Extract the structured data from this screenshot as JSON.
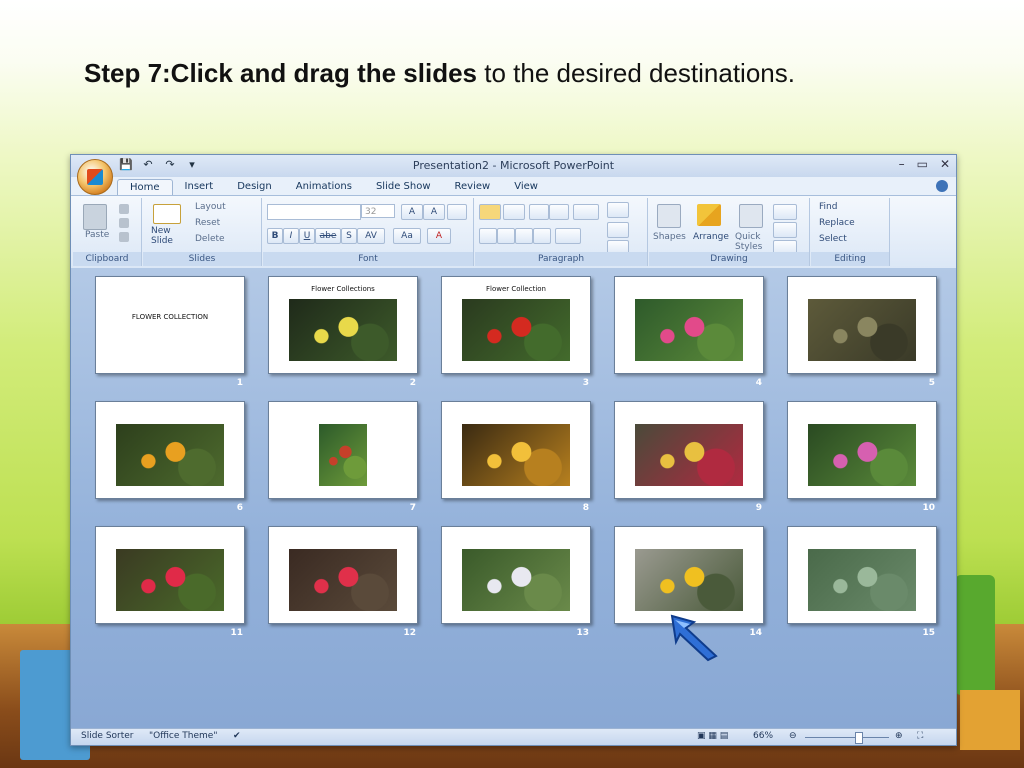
{
  "slide": {
    "title_bold": "Step 7:Click and drag the slides",
    "title_rest": " to the desired destinations."
  },
  "window": {
    "title": "Presentation2 - Microsoft PowerPoint",
    "controls": [
      "–",
      "▭",
      "✕"
    ]
  },
  "quick_access": [
    "💾",
    "↶",
    "↷",
    "▾"
  ],
  "tabs": [
    "Home",
    "Insert",
    "Design",
    "Animations",
    "Slide Show",
    "Review",
    "View"
  ],
  "ribbon": {
    "clipboard": {
      "label": "Clipboard",
      "paste": "Paste"
    },
    "slides": {
      "label": "Slides",
      "new_slide": "New Slide",
      "layout": "Layout",
      "reset": "Reset",
      "delete": "Delete"
    },
    "font": {
      "label": "Font",
      "size": "32",
      "bold": "B",
      "italic": "I",
      "underline": "U",
      "strike": "abe",
      "shadow": "S",
      "spacing": "AV",
      "case": "Aa",
      "color": "A"
    },
    "paragraph": {
      "label": "Paragraph"
    },
    "drawing": {
      "label": "Drawing",
      "shapes": "Shapes",
      "arrange": "Arrange",
      "quick_styles": "Quick Styles"
    },
    "editing": {
      "label": "Editing",
      "find": "Find",
      "replace": "Replace",
      "select": "Select"
    }
  },
  "slides": [
    {
      "num": "1",
      "title": "",
      "text": "FLOWER COLLECTION",
      "colors": []
    },
    {
      "num": "2",
      "title": "Flower Collections",
      "text": "",
      "colors": [
        "#1f2a1a",
        "#e8d94a",
        "#3d5a2a"
      ]
    },
    {
      "num": "3",
      "title": "Flower Collection",
      "text": "",
      "colors": [
        "#2a3a1f",
        "#d42a20",
        "#436b2c"
      ]
    },
    {
      "num": "4",
      "title": "",
      "text": "",
      "colors": [
        "#2e5a2b",
        "#e24a8a",
        "#5b8a3a"
      ]
    },
    {
      "num": "5",
      "title": "",
      "text": "",
      "colors": [
        "#5d5a3a",
        "#8a8660",
        "#3a3a28"
      ]
    },
    {
      "num": "6",
      "title": "",
      "text": "",
      "colors": [
        "#2d3f1c",
        "#e8a020",
        "#4e6b2e"
      ]
    },
    {
      "num": "7",
      "title": "",
      "text": "",
      "colors": [
        "#2c5a2a",
        "#c5402a",
        "#6e9b3a"
      ]
    },
    {
      "num": "8",
      "title": "",
      "text": "",
      "colors": [
        "#3a2a12",
        "#f2c03a",
        "#b7801f"
      ]
    },
    {
      "num": "9",
      "title": "",
      "text": "",
      "colors": [
        "#4a4a3a",
        "#e8c040",
        "#b02a40"
      ]
    },
    {
      "num": "10",
      "title": "",
      "text": "",
      "colors": [
        "#2a4a22",
        "#d660b0",
        "#5a8a3a"
      ]
    },
    {
      "num": "11",
      "title": "",
      "text": "",
      "colors": [
        "#3a3a22",
        "#e02a48",
        "#4a6a2a"
      ]
    },
    {
      "num": "12",
      "title": "",
      "text": "",
      "colors": [
        "#3a2a22",
        "#e0304a",
        "#5a4a3a"
      ]
    },
    {
      "num": "13",
      "title": "",
      "text": "",
      "colors": [
        "#3a5a2a",
        "#e8e8f0",
        "#6a8a4a"
      ]
    },
    {
      "num": "14",
      "title": "",
      "text": "",
      "colors": [
        "#9a9a90",
        "#f0c020",
        "#4a5a3a"
      ]
    },
    {
      "num": "15",
      "title": "",
      "text": "",
      "colors": [
        "#4a6a4a",
        "#9ab89a",
        "#6a8a6a"
      ]
    }
  ],
  "status": {
    "view": "Slide Sorter",
    "theme": "\"Office Theme\"",
    "zoom": "66%"
  }
}
